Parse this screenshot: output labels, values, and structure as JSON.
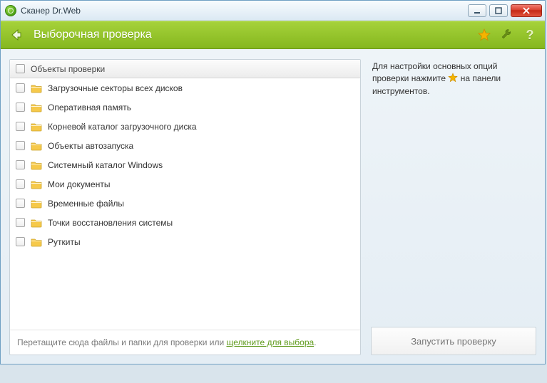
{
  "window": {
    "title": "Сканер Dr.Web"
  },
  "header": {
    "title": "Выборочная проверка"
  },
  "list": {
    "header": "Объекты проверки",
    "items": [
      {
        "label": "Загрузочные секторы всех дисков"
      },
      {
        "label": "Оперативная память"
      },
      {
        "label": "Корневой каталог загрузочного диска"
      },
      {
        "label": "Объекты автозапуска"
      },
      {
        "label": "Системный каталог Windows"
      },
      {
        "label": "Мои документы"
      },
      {
        "label": "Временные файлы"
      },
      {
        "label": "Точки восстановления системы"
      },
      {
        "label": "Руткиты"
      }
    ]
  },
  "drop_hint": {
    "prefix": "Перетащите сюда файлы и папки для проверки или ",
    "link": "щелкните для выбора",
    "suffix": "."
  },
  "side_hint": {
    "line1": "Для настройки основных опций",
    "line2a": "проверки нажмите ",
    "line2b": " на панели",
    "line3": "инструментов."
  },
  "run_button": {
    "label": "Запустить проверку"
  }
}
